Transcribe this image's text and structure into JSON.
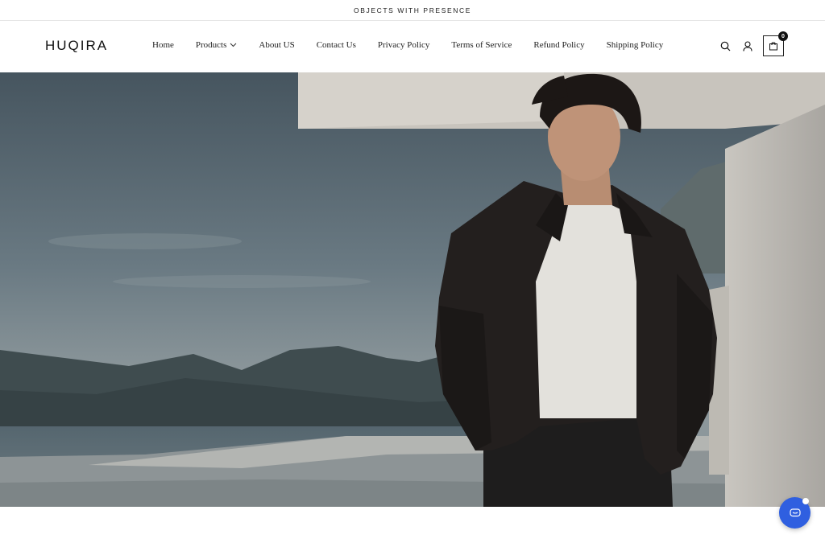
{
  "announcement": {
    "text": "OBJECTS WITH PRESENCE"
  },
  "header": {
    "logo": "HUQIRA",
    "nav": [
      {
        "label": "Home",
        "has_dropdown": false
      },
      {
        "label": "Products",
        "has_dropdown": true
      },
      {
        "label": "About US",
        "has_dropdown": false
      },
      {
        "label": "Contact Us",
        "has_dropdown": false
      },
      {
        "label": "Privacy Policy",
        "has_dropdown": false
      },
      {
        "label": "Terms of Service",
        "has_dropdown": false
      },
      {
        "label": "Refund Policy",
        "has_dropdown": false
      },
      {
        "label": "Shipping Policy",
        "has_dropdown": false
      }
    ],
    "icons": [
      "search-icon",
      "account-icon",
      "cart-icon"
    ],
    "cart_count": "0"
  },
  "hero": {
    "image": "man-in-black-jacket-lakeside-architecture"
  },
  "chat": {
    "icon": "chat-icon",
    "color": "#2f5fe0"
  }
}
